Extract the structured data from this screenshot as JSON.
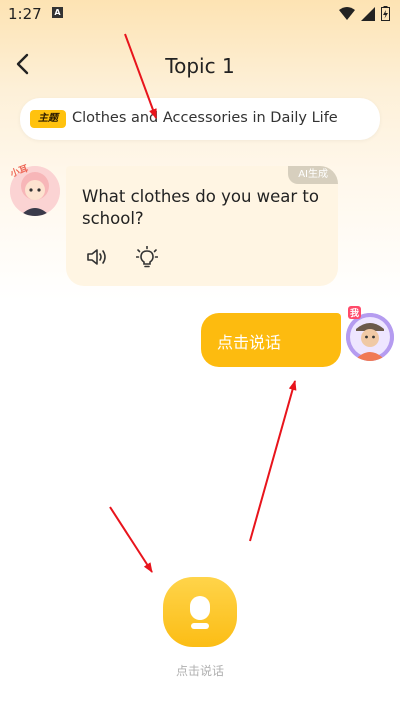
{
  "status_bar": {
    "time": "1:27",
    "notification_icon": "A"
  },
  "header": {
    "title": "Topic 1"
  },
  "topic": {
    "tag": "主题",
    "text": "Clothes and Accessories in Daily Life"
  },
  "ai_message": {
    "avatar_tag": "小耳",
    "badge": "AI生成",
    "question": "What clothes do you wear to school?"
  },
  "user_message": {
    "avatar_tag": "我",
    "text": "点击说话"
  },
  "mic": {
    "caption": "点击说话"
  },
  "colors": {
    "accent": "#fdbb0f",
    "arrow": "#e8141c"
  }
}
